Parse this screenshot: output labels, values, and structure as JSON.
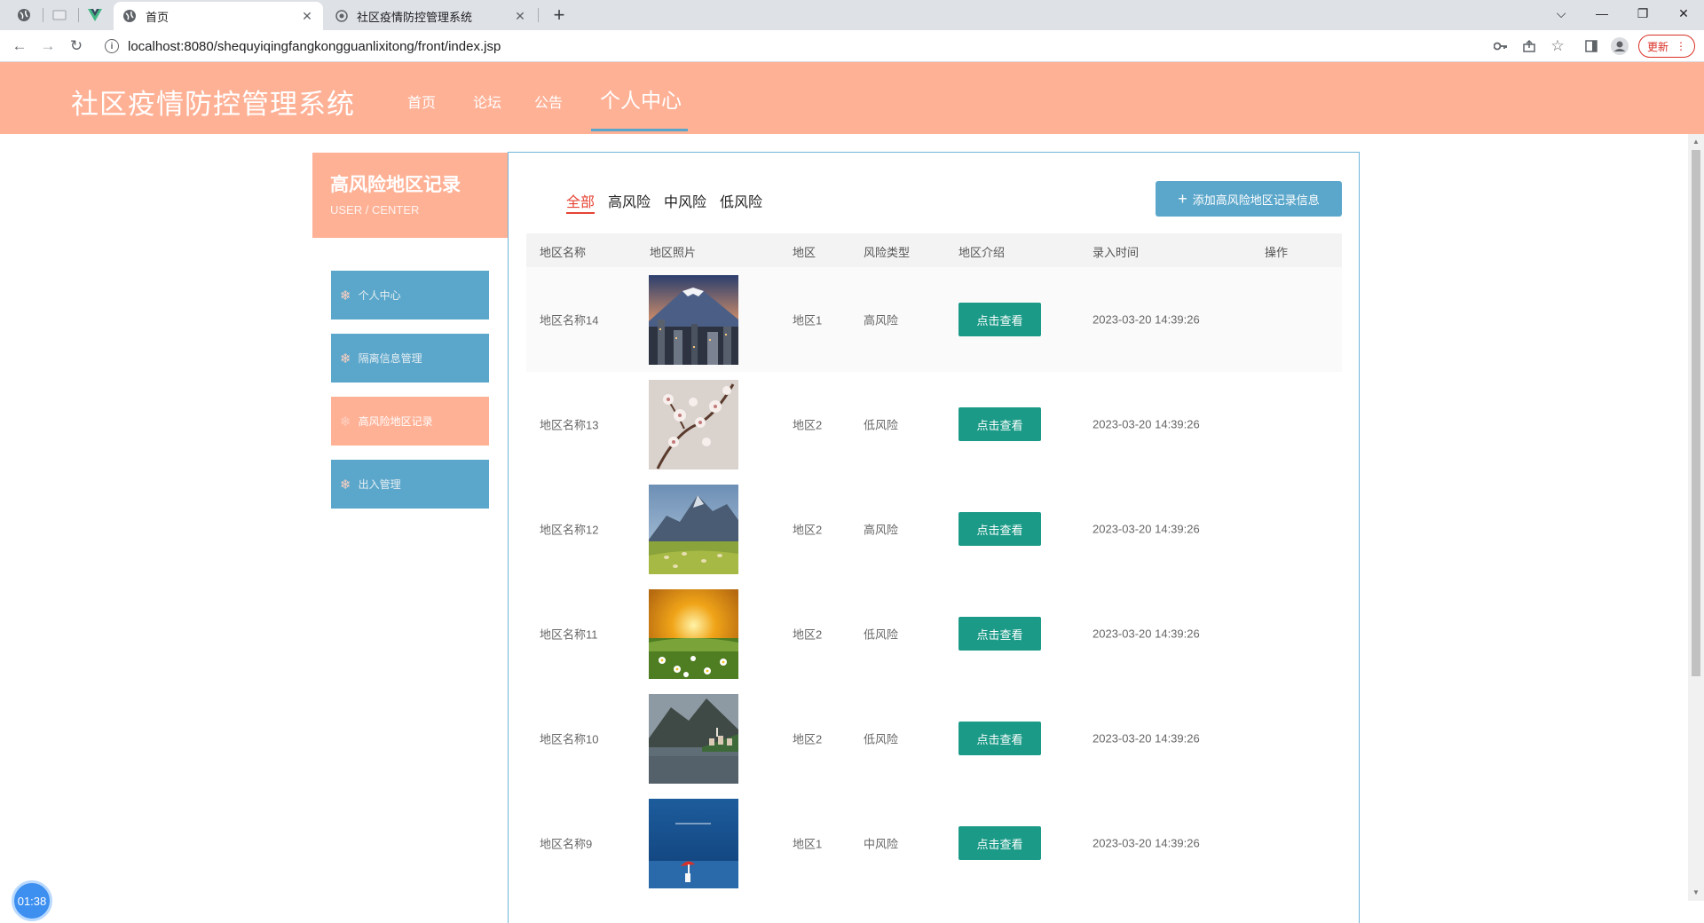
{
  "browser": {
    "tabs": [
      {
        "title": "首页",
        "active": true
      },
      {
        "title": "社区疫情防控管理系统",
        "active": false
      }
    ],
    "url": "localhost:8080/shequyiqingfangkongguanlixitong/front/index.jsp",
    "update_label": "更新"
  },
  "header": {
    "title": "社区疫情防控管理系统",
    "nav": [
      "首页",
      "论坛",
      "公告",
      "个人中心"
    ],
    "active_nav": "个人中心"
  },
  "sidebar": {
    "title": "高风险地区记录",
    "subtitle": "USER / CENTER",
    "items": [
      "个人中心",
      "隔离信息管理",
      "高风险地区记录",
      "出入管理"
    ],
    "active_item": "高风险地区记录"
  },
  "filters": [
    "全部",
    "高风险",
    "中风险",
    "低风险"
  ],
  "active_filter": "全部",
  "add_button_label": "添加高风险地区记录信息",
  "table": {
    "headers": [
      "地区名称",
      "地区照片",
      "地区",
      "风险类型",
      "地区介绍",
      "录入时间",
      "操作"
    ],
    "view_label": "点击查看",
    "rows": [
      {
        "name": "地区名称14",
        "photo": "mountain-city",
        "area": "地区1",
        "risk": "高风险",
        "time": "2023-03-20 14:39:26"
      },
      {
        "name": "地区名称13",
        "photo": "cherry-blossom",
        "area": "地区2",
        "risk": "低风险",
        "time": "2023-03-20 14:39:26"
      },
      {
        "name": "地区名称12",
        "photo": "mountain-meadow",
        "area": "地区2",
        "risk": "高风险",
        "time": "2023-03-20 14:39:26"
      },
      {
        "name": "地区名称11",
        "photo": "sunset-flowers",
        "area": "地区2",
        "risk": "低风险",
        "time": "2023-03-20 14:39:26"
      },
      {
        "name": "地区名称10",
        "photo": "lake-village",
        "area": "地区2",
        "risk": "低风险",
        "time": "2023-03-20 14:39:26"
      },
      {
        "name": "地区名称9",
        "photo": "sea-umbrella",
        "area": "地区1",
        "risk": "中风险",
        "time": "2023-03-20 14:39:26"
      }
    ]
  },
  "timer": "01:38"
}
